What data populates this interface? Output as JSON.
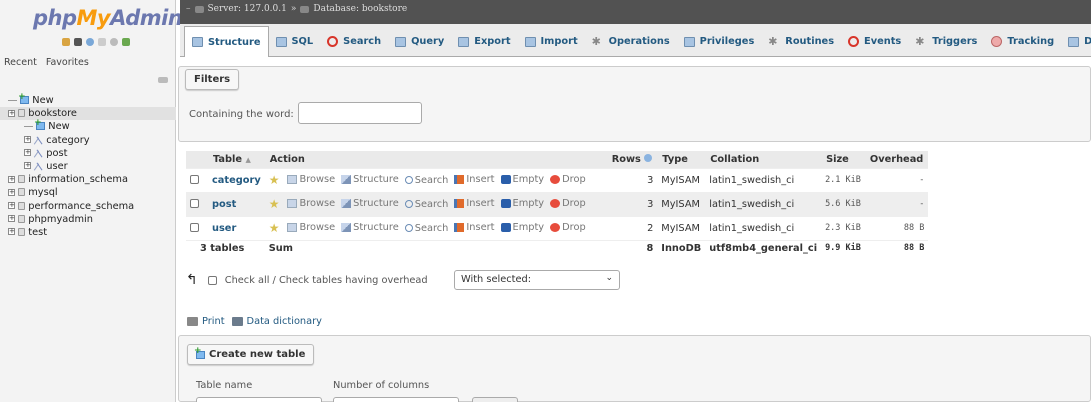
{
  "app": {
    "logo_php": "php",
    "logo_my": "My",
    "logo_admin": "Admin"
  },
  "sidebar": {
    "recent_label": "Recent",
    "favorites_label": "Favorites",
    "tree": [
      {
        "label": "New",
        "level": 0,
        "kind": "new"
      },
      {
        "label": "bookstore",
        "level": 0,
        "kind": "db",
        "selected": true
      },
      {
        "label": "New",
        "level": 1,
        "kind": "new"
      },
      {
        "label": "category",
        "level": 1,
        "kind": "table"
      },
      {
        "label": "post",
        "level": 1,
        "kind": "table"
      },
      {
        "label": "user",
        "level": 1,
        "kind": "table"
      },
      {
        "label": "information_schema",
        "level": 0,
        "kind": "db"
      },
      {
        "label": "mysql",
        "level": 0,
        "kind": "db"
      },
      {
        "label": "performance_schema",
        "level": 0,
        "kind": "db"
      },
      {
        "label": "phpmyadmin",
        "level": 0,
        "kind": "db"
      },
      {
        "label": "test",
        "level": 0,
        "kind": "db"
      }
    ]
  },
  "breadcrumb": {
    "server": "Server: 127.0.0.1",
    "sep": "»",
    "database": "Database: bookstore"
  },
  "tabs": [
    {
      "label": "Structure",
      "icon": "structure-icon",
      "active": true
    },
    {
      "label": "SQL",
      "icon": "sql-icon"
    },
    {
      "label": "Search",
      "icon": "search-icon"
    },
    {
      "label": "Query",
      "icon": "query-icon"
    },
    {
      "label": "Export",
      "icon": "export-icon"
    },
    {
      "label": "Import",
      "icon": "import-icon"
    },
    {
      "label": "Operations",
      "icon": "wrench-icon"
    },
    {
      "label": "Privileges",
      "icon": "privileges-icon"
    },
    {
      "label": "Routines",
      "icon": "routines-icon"
    },
    {
      "label": "Events",
      "icon": "clock-icon"
    },
    {
      "label": "Triggers",
      "icon": "triggers-icon"
    },
    {
      "label": "Tracking",
      "icon": "tracking-icon"
    },
    {
      "label": "Designer",
      "icon": "designer-icon"
    }
  ],
  "filters": {
    "legend": "Filters",
    "label": "Containing the word:",
    "value": ""
  },
  "table": {
    "headers": {
      "table": "Table",
      "sort": "▲",
      "action": "Action",
      "rows": "Rows",
      "type": "Type",
      "collation": "Collation",
      "size": "Size",
      "overhead": "Overhead"
    },
    "actions": [
      "Browse",
      "Structure",
      "Search",
      "Insert",
      "Empty",
      "Drop"
    ],
    "rows": [
      {
        "name": "category",
        "rows": "3",
        "type": "MyISAM",
        "collation": "latin1_swedish_ci",
        "size": "2.1 KiB",
        "overhead": "-"
      },
      {
        "name": "post",
        "rows": "3",
        "type": "MyISAM",
        "collation": "latin1_swedish_ci",
        "size": "5.6 KiB",
        "overhead": "-"
      },
      {
        "name": "user",
        "rows": "2",
        "type": "MyISAM",
        "collation": "latin1_swedish_ci",
        "size": "2.3 KiB",
        "overhead": "88 B"
      }
    ],
    "sum": {
      "tables": "3 tables",
      "label": "Sum",
      "rows": "8",
      "type": "InnoDB",
      "collation": "utf8mb4_general_ci",
      "size": "9.9 KiB",
      "overhead": "88 B"
    }
  },
  "checkall": {
    "label": "Check all / Check tables having overhead",
    "with_selected": "With selected:"
  },
  "links": {
    "print": "Print",
    "data_dictionary": "Data dictionary"
  },
  "create": {
    "legend": "Create new table",
    "table_name_label": "Table name",
    "columns_label": "Number of columns"
  }
}
